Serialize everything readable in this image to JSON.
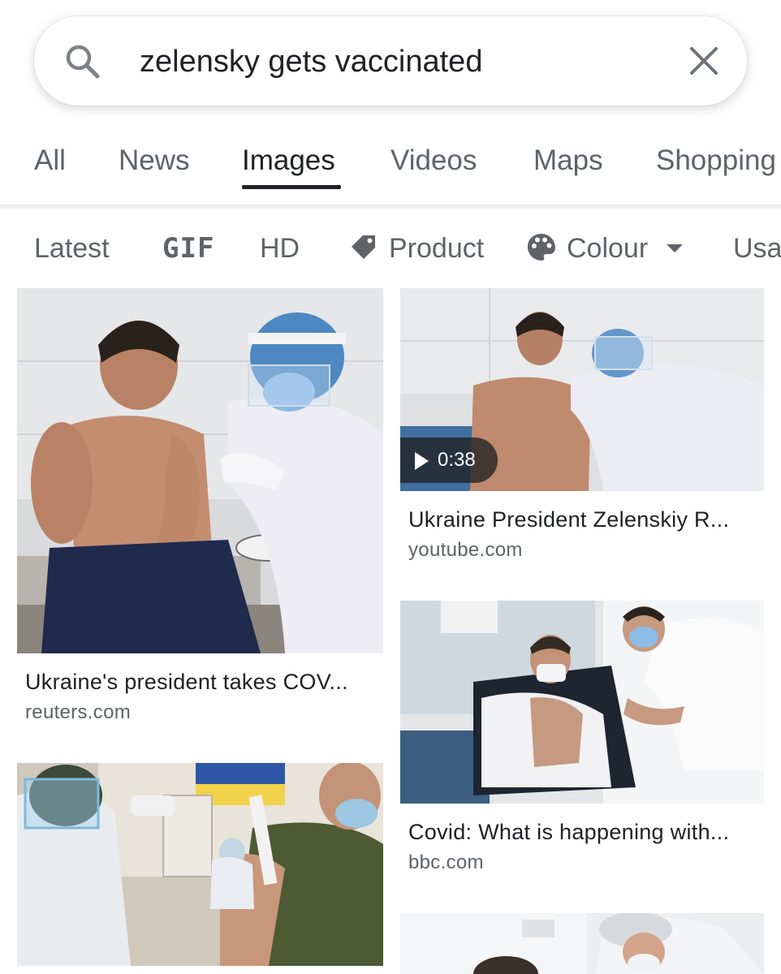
{
  "search": {
    "query": "zelensky gets vaccinated",
    "search_icon": "search-icon",
    "clear_icon": "close-icon"
  },
  "tabs": [
    {
      "label": "All",
      "active": false
    },
    {
      "label": "News",
      "active": false
    },
    {
      "label": "Images",
      "active": true
    },
    {
      "label": "Videos",
      "active": false
    },
    {
      "label": "Maps",
      "active": false
    },
    {
      "label": "Shopping",
      "active": false
    }
  ],
  "chips": [
    {
      "label": "Latest"
    },
    {
      "label": "GIF"
    },
    {
      "label": "HD"
    },
    {
      "label": "Product",
      "icon": "tag-icon"
    },
    {
      "label": "Colour",
      "icon": "palette-icon",
      "dropdown_icon": "caret-down-icon"
    },
    {
      "label": "Usage"
    }
  ],
  "results": [
    {
      "title": "Ukraine's president takes COV...",
      "source": "reuters.com"
    },
    {
      "title": "Ukraine President Zelenskiy R...",
      "source": "youtube.com",
      "duration": "0:38"
    },
    {
      "title": "Covid: What is happening with...",
      "source": "bbc.com"
    },
    {
      "title": "",
      "source": ""
    },
    {
      "title": "",
      "source": ""
    }
  ],
  "colors": {
    "text_primary": "#202124",
    "text_secondary": "#5f6368",
    "active_underline": "#202124"
  }
}
